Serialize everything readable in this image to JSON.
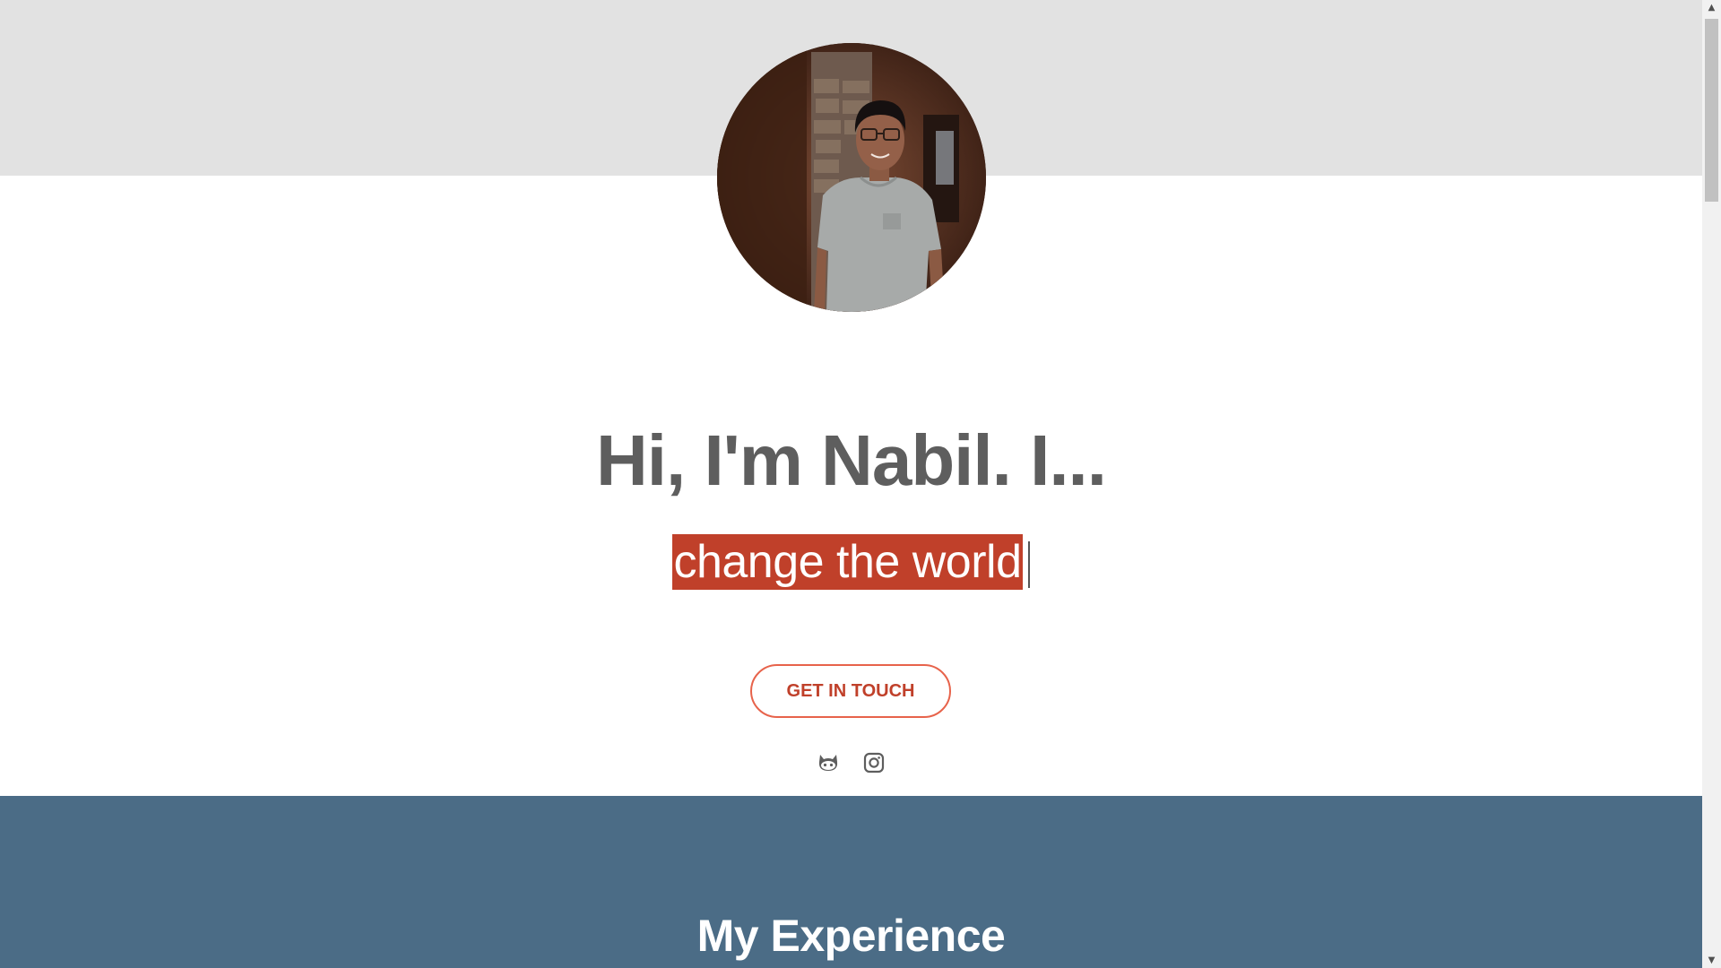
{
  "hero": {
    "headline": "Hi, I'm Nabil. I...",
    "typed_text": "change the world",
    "cta_label": "GET IN TOUCH",
    "avatar": "profile-photo"
  },
  "socials": [
    {
      "icon": "github-icon"
    },
    {
      "icon": "instagram-icon"
    }
  ],
  "experience": {
    "title": "My Experience"
  },
  "colors": {
    "top_band": "#e2e2e2",
    "headline": "#5e5e5e",
    "highlight": "#c0402a",
    "cta_border": "#e7634b",
    "experience_bg": "#4b6c86"
  },
  "scrollbar": {
    "up_arrow": "▲",
    "down_arrow": "▼"
  }
}
